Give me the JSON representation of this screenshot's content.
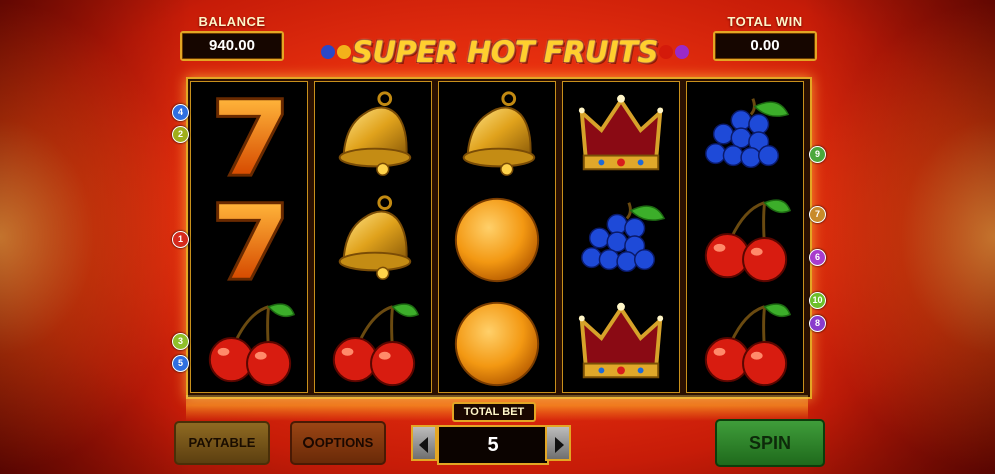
{
  "balance": {
    "label": "BALANCE",
    "value": "940.00"
  },
  "total_win": {
    "label": "TOTAL WIN",
    "value": "0.00"
  },
  "logo": {
    "title": "SUPER HOT FRUITS"
  },
  "reels": [
    [
      "seven",
      "seven",
      "cherry"
    ],
    [
      "bell",
      "bell",
      "cherry"
    ],
    [
      "bell",
      "orange",
      "orange"
    ],
    [
      "crown",
      "grapes",
      "crown"
    ],
    [
      "grapes",
      "cherry",
      "cherry"
    ]
  ],
  "paylines_left": [
    "4",
    "2",
    "1",
    "3",
    "5"
  ],
  "paylines_right": [
    "9",
    "7",
    "6",
    "10",
    "8"
  ],
  "buttons": {
    "paytable": "PAYTABLE",
    "options": "OPTIONS",
    "spin": "SPIN"
  },
  "total_bet": {
    "label": "TOTAL BET",
    "value": "5"
  },
  "colors": {
    "payline_1": "#d62a1c",
    "payline_2": "#9fae1a",
    "payline_3": "#8fbf2a",
    "payline_4": "#2f6fe0",
    "payline_5": "#2f6fe0",
    "payline_6": "#a83ccc",
    "payline_7": "#c88a2a",
    "payline_8": "#8a3ccc",
    "payline_9": "#4aa83c",
    "payline_10": "#6cbf2a",
    "frame_gold": "#e3a624"
  }
}
